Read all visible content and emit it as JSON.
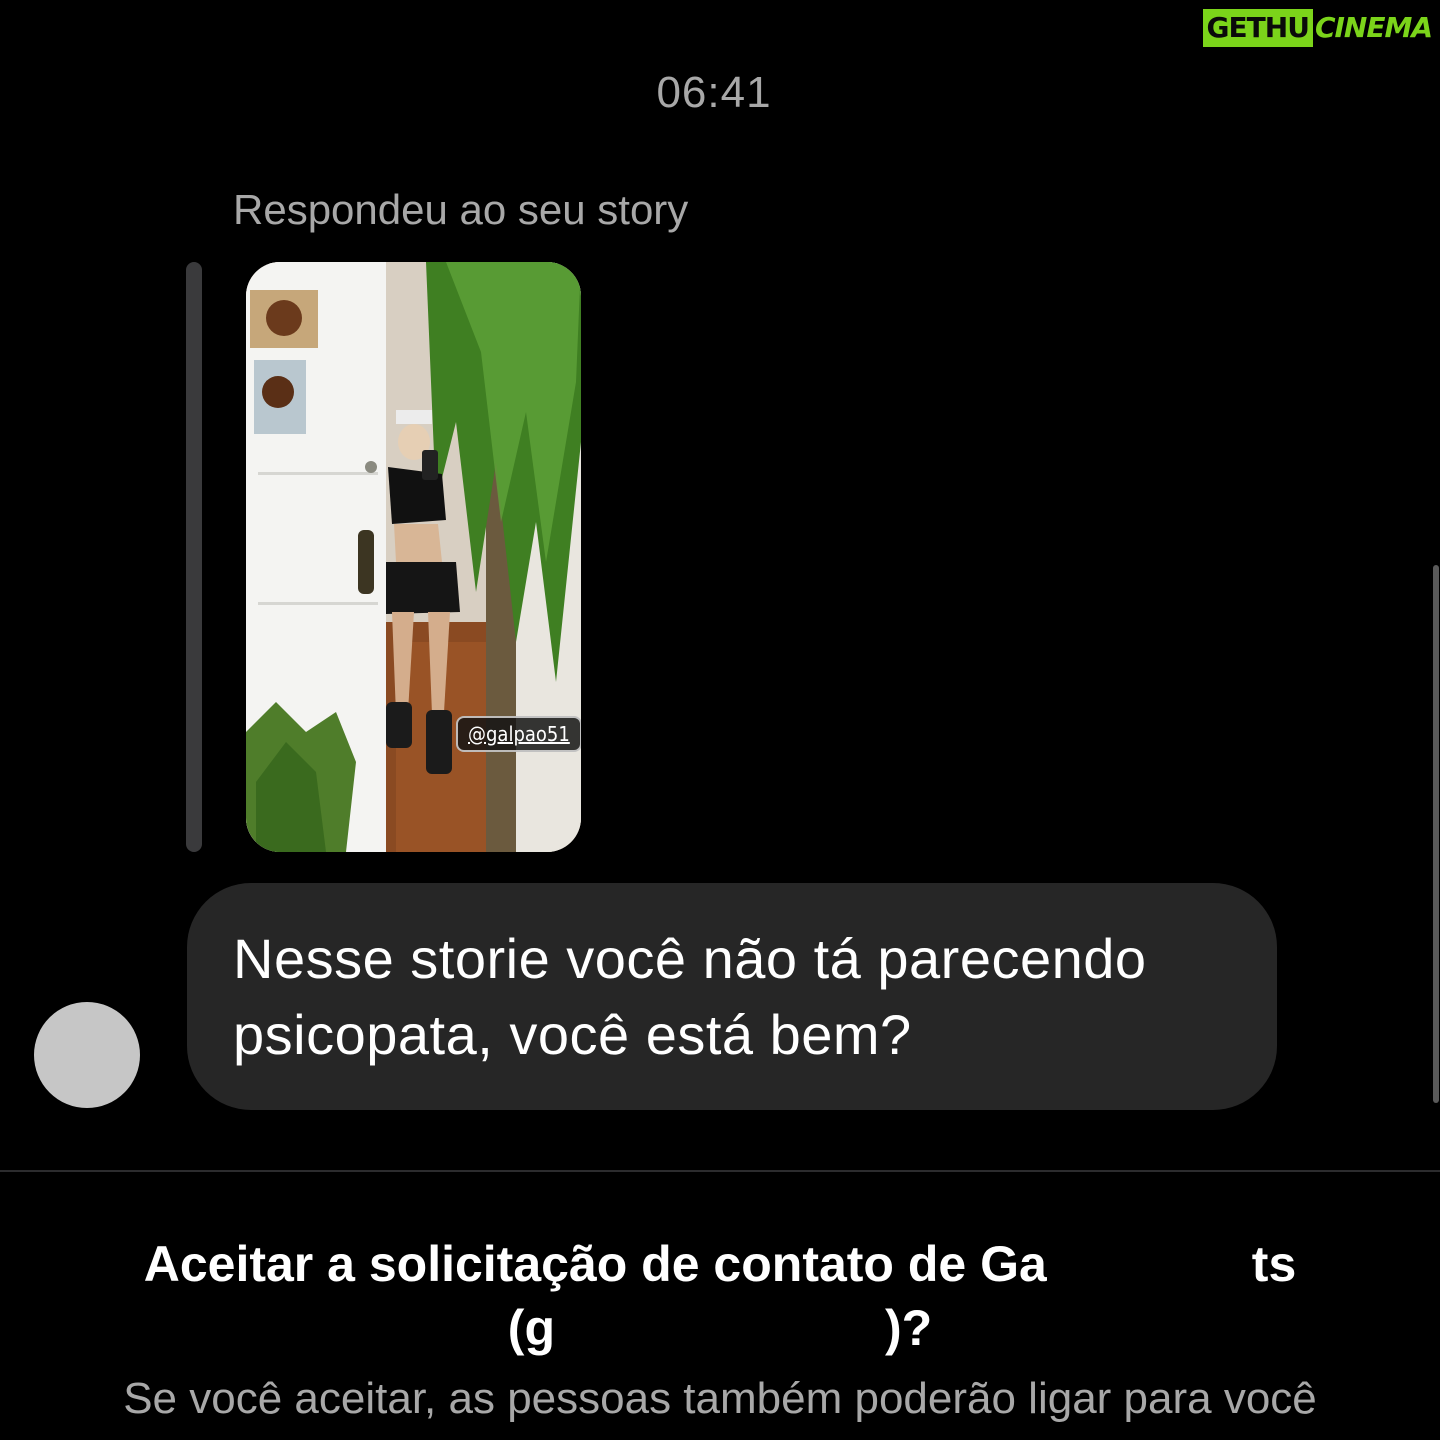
{
  "watermark": {
    "left_text": "GETHU",
    "right_text": "CINEMA",
    "accent_color": "#7bd41a"
  },
  "thread": {
    "timestamp": "06:41",
    "story_reply_caption": "Respondeu ao seu story",
    "story": {
      "mention_tag": "@galpao51"
    },
    "message": {
      "text": "Nesse storie você não tá parecendo psicopata, você está bem?"
    }
  },
  "request": {
    "title_part1": "Aceitar a solicitação de contato de Ga",
    "title_part2": "ts",
    "title_part3": "(g",
    "title_part4": ")?",
    "body": "Se você aceitar, as pessoas também poderão ligar para você"
  },
  "colors": {
    "background": "#000000",
    "bubble": "#262626",
    "secondary_text": "#a8a8a8"
  }
}
